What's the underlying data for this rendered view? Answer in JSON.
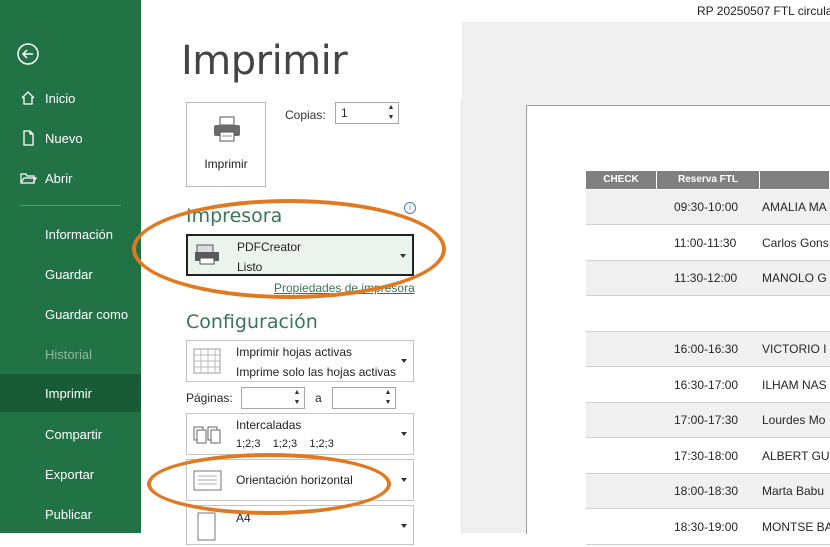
{
  "window": {
    "doc_title": "RP 20250507 FTL circulaci"
  },
  "sidebar": {
    "items": [
      {
        "label": "Inicio",
        "icon": "home-icon"
      },
      {
        "label": "Nuevo",
        "icon": "new-file-icon"
      },
      {
        "label": "Abrir",
        "icon": "open-folder-icon"
      },
      {
        "label": "Información"
      },
      {
        "label": "Guardar"
      },
      {
        "label": "Guardar como"
      },
      {
        "label": "Historial"
      },
      {
        "label": "Imprimir"
      },
      {
        "label": "Compartir"
      },
      {
        "label": "Exportar"
      },
      {
        "label": "Publicar"
      }
    ]
  },
  "main": {
    "title": "Imprimir",
    "print_button": "Imprimir",
    "copies_label": "Copias:",
    "copies_value": "1",
    "printer_heading": "Impresora",
    "printer": {
      "name": "PDFCreator",
      "status": "Listo"
    },
    "printer_properties": "Propiedades de impresora",
    "settings_heading": "Configuración",
    "scope": {
      "line1": "Imprimir hojas activas",
      "line2": "Imprime solo las hojas activas"
    },
    "pages_label": "Páginas:",
    "pages_to": "a",
    "collation": {
      "line1": "Intercaladas",
      "line2": "1;2;3    1;2;3    1;2;3"
    },
    "orientation": "Orientación horizontal",
    "paper": {
      "line1": "A4"
    }
  },
  "preview": {
    "headers": [
      "CHECK",
      "Reserva FTL",
      ""
    ],
    "rows": [
      {
        "time": "09:30-10:00",
        "name": "AMALIA  MA"
      },
      {
        "time": "11:00-11:30",
        "name": "Carlos  Gons"
      },
      {
        "time": "11:30-12:00",
        "name": "MANOLO G"
      },
      {
        "time": "",
        "name": ""
      },
      {
        "time": "16:00-16:30",
        "name": "VICTORIO  I"
      },
      {
        "time": "16:30-17:00",
        "name": "ILHAM NAS"
      },
      {
        "time": "17:00-17:30",
        "name": "Lourdes Mo"
      },
      {
        "time": "17:30-18:00",
        "name": "ALBERT GU"
      },
      {
        "time": "18:00-18:30",
        "name": "Marta Babu"
      },
      {
        "time": "18:30-19:00",
        "name": "MONTSE BA"
      }
    ]
  },
  "colors": {
    "sidebar": "#217346",
    "sidebar_active": "#185c37",
    "accent": "#3a7555",
    "highlight_ring": "#e07a22"
  }
}
